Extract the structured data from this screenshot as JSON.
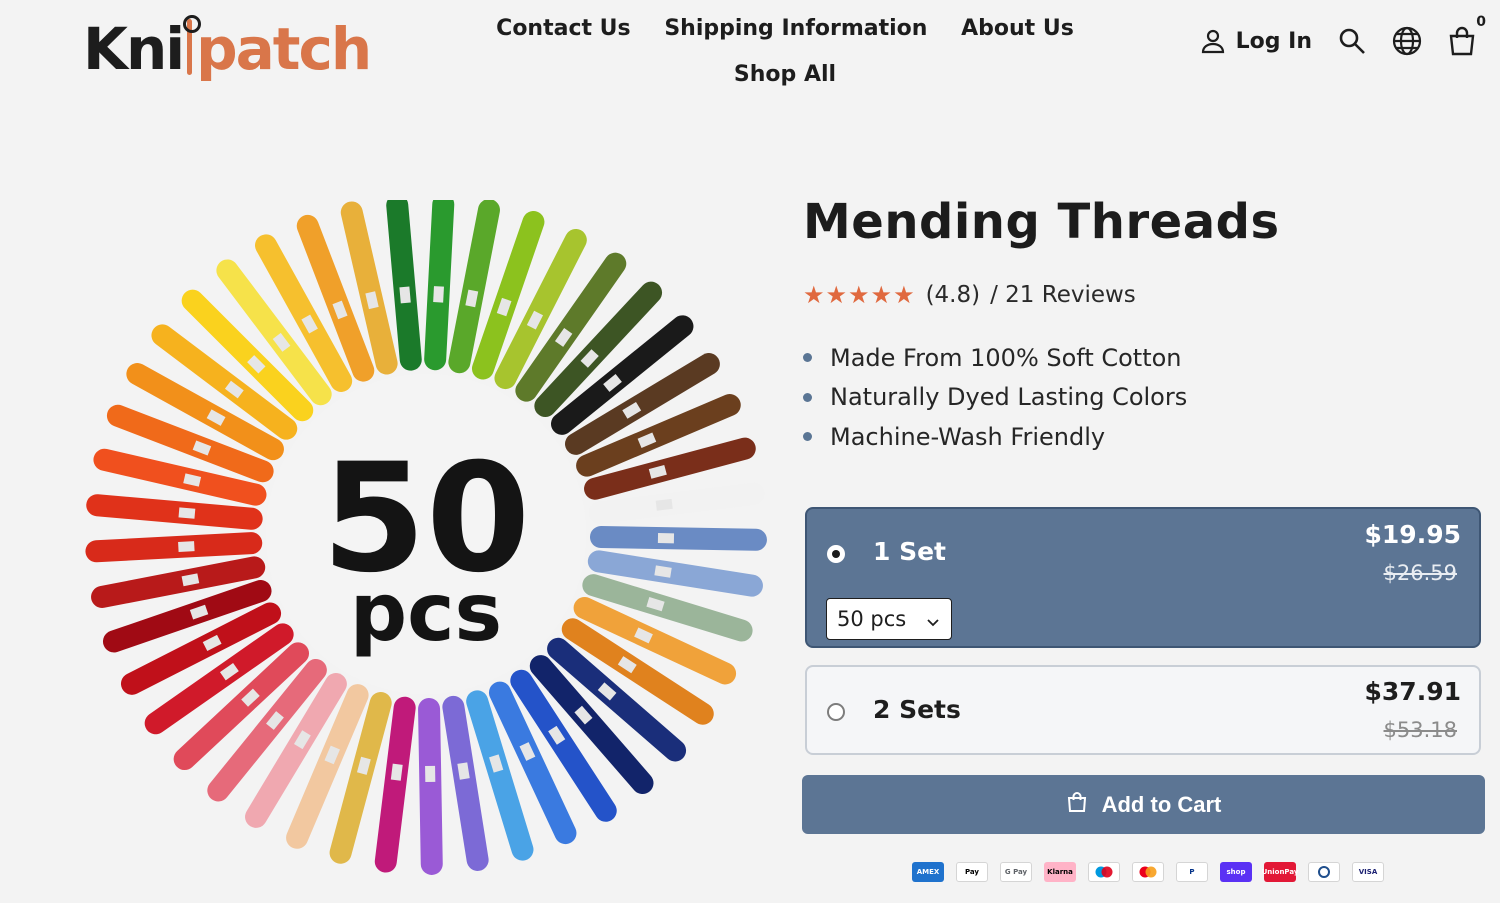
{
  "brand": {
    "logo_part1": "Kni",
    "logo_part2": "patch"
  },
  "nav": {
    "items": [
      "Contact Us",
      "Shipping Information",
      "About Us",
      "Shop All"
    ]
  },
  "header": {
    "login_label": "Log In",
    "cart_count": "0",
    "icons": [
      "user-icon",
      "search-icon",
      "globe-icon",
      "cart-icon"
    ]
  },
  "product": {
    "title": "Mending Threads",
    "rating_value": "(4.8)",
    "reviews_text": "/ 21 Reviews",
    "stars": 5,
    "features": [
      "Made From 100% Soft Cotton",
      "Naturally Dyed Lasting Colors",
      "Machine-Wash Friendly"
    ],
    "image_badge": {
      "number": "50",
      "unit": "pcs"
    }
  },
  "options": [
    {
      "label": "1 Set",
      "price": "$19.95",
      "old_price": "$26.59",
      "selected": true,
      "select_value": "50 pcs"
    },
    {
      "label": "2 Sets",
      "price": "$37.91",
      "old_price": "$53.18",
      "selected": false
    }
  ],
  "add_to_cart_label": "Add to Cart",
  "payment_methods": [
    {
      "name": "amex",
      "label": "AMEX",
      "bg": "#1f72cd",
      "fg": "#ffffff"
    },
    {
      "name": "apple-pay",
      "label": "Pay",
      "bg": "#ffffff",
      "fg": "#000000"
    },
    {
      "name": "google-pay",
      "label": "G Pay",
      "bg": "#ffffff",
      "fg": "#5f6368"
    },
    {
      "name": "klarna",
      "label": "Klarna",
      "bg": "#ffb3c7",
      "fg": "#000000"
    },
    {
      "name": "maestro",
      "label": "",
      "bg": "#ffffff",
      "fg": "#000000"
    },
    {
      "name": "mastercard",
      "label": "",
      "bg": "#ffffff",
      "fg": "#000000"
    },
    {
      "name": "paypal",
      "label": "P",
      "bg": "#ffffff",
      "fg": "#003087"
    },
    {
      "name": "shop-pay",
      "label": "shop",
      "bg": "#5a31f4",
      "fg": "#ffffff"
    },
    {
      "name": "unionpay",
      "label": "UnionPay",
      "bg": "#e21836",
      "fg": "#ffffff"
    },
    {
      "name": "venmo",
      "label": "",
      "bg": "#ffffff",
      "fg": "#1f4e8c"
    },
    {
      "name": "visa",
      "label": "VISA",
      "bg": "#ffffff",
      "fg": "#1a1f71"
    }
  ],
  "colors": {
    "accent": "#5c7594",
    "star": "#e0693f",
    "brand_orange": "#d9764a"
  }
}
